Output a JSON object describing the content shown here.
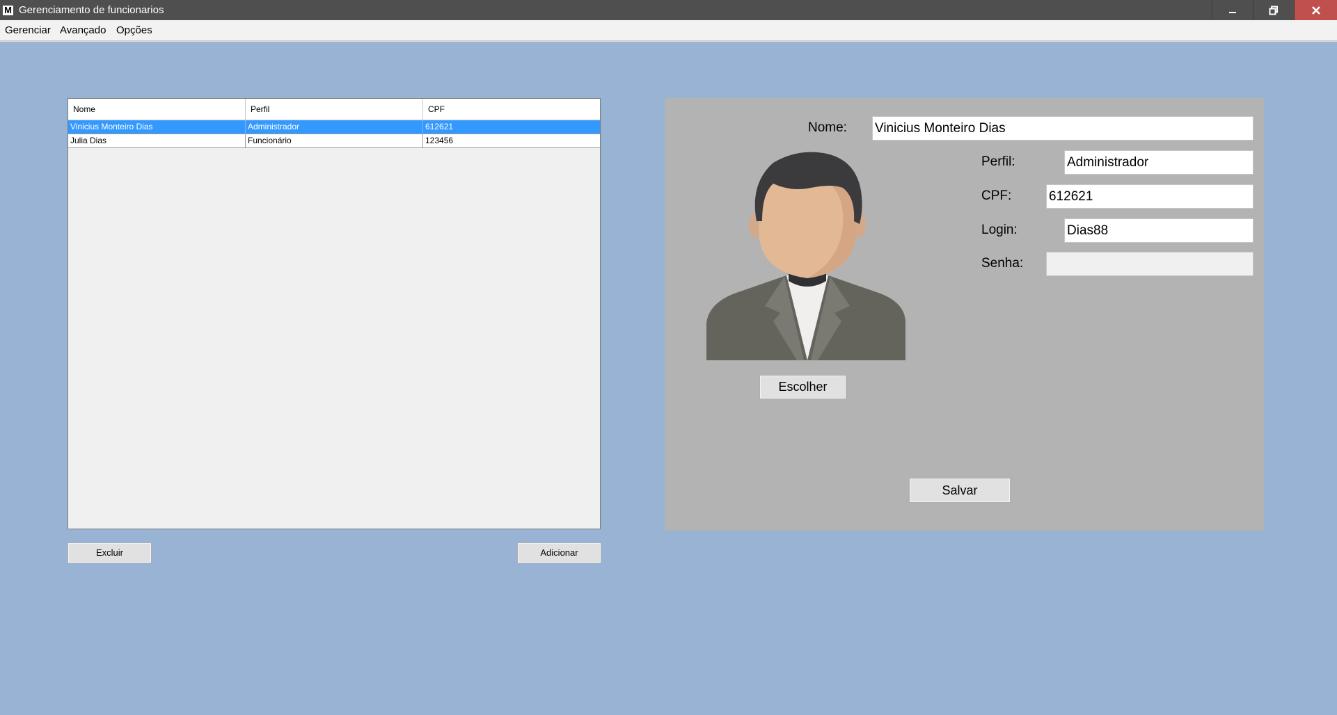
{
  "window": {
    "icon_letter": "M",
    "title": "Gerenciamento de funcionarios",
    "minimize_icon": "minimize-icon",
    "restore_icon": "restore-icon",
    "close_icon": "close-icon"
  },
  "menu": {
    "items": [
      "Gerenciar",
      "Avançado",
      "Opções"
    ]
  },
  "table": {
    "columns": [
      "Nome",
      "Perfil",
      "CPF"
    ],
    "rows": [
      {
        "nome": "Vinicius Monteiro Dias",
        "perfil": "Administrador",
        "cpf": "612621",
        "selected": true
      },
      {
        "nome": "Julia Dias",
        "perfil": "Funcionário",
        "cpf": "123456",
        "selected": false
      }
    ],
    "selected_color": "#3399ff"
  },
  "actions": {
    "delete_label": "Excluir",
    "add_label": "Adicionar"
  },
  "form": {
    "nome_label": "Nome:",
    "nome_value": "Vinicius Monteiro Dias",
    "perfil_label": "Perfil:",
    "perfil_value": "Administrador",
    "cpf_label": "CPF:",
    "cpf_value": "612621",
    "login_label": "Login:",
    "login_value": "Dias88",
    "senha_label": "Senha:",
    "senha_value": "",
    "choose_label": "Escolher",
    "save_label": "Salvar",
    "avatar_icon": "user-avatar-icon"
  },
  "colors": {
    "background": "#98b3d3",
    "form_panel": "#b3b3b3",
    "titlebar": "#4f4f4f",
    "close_button": "#c0504d"
  }
}
